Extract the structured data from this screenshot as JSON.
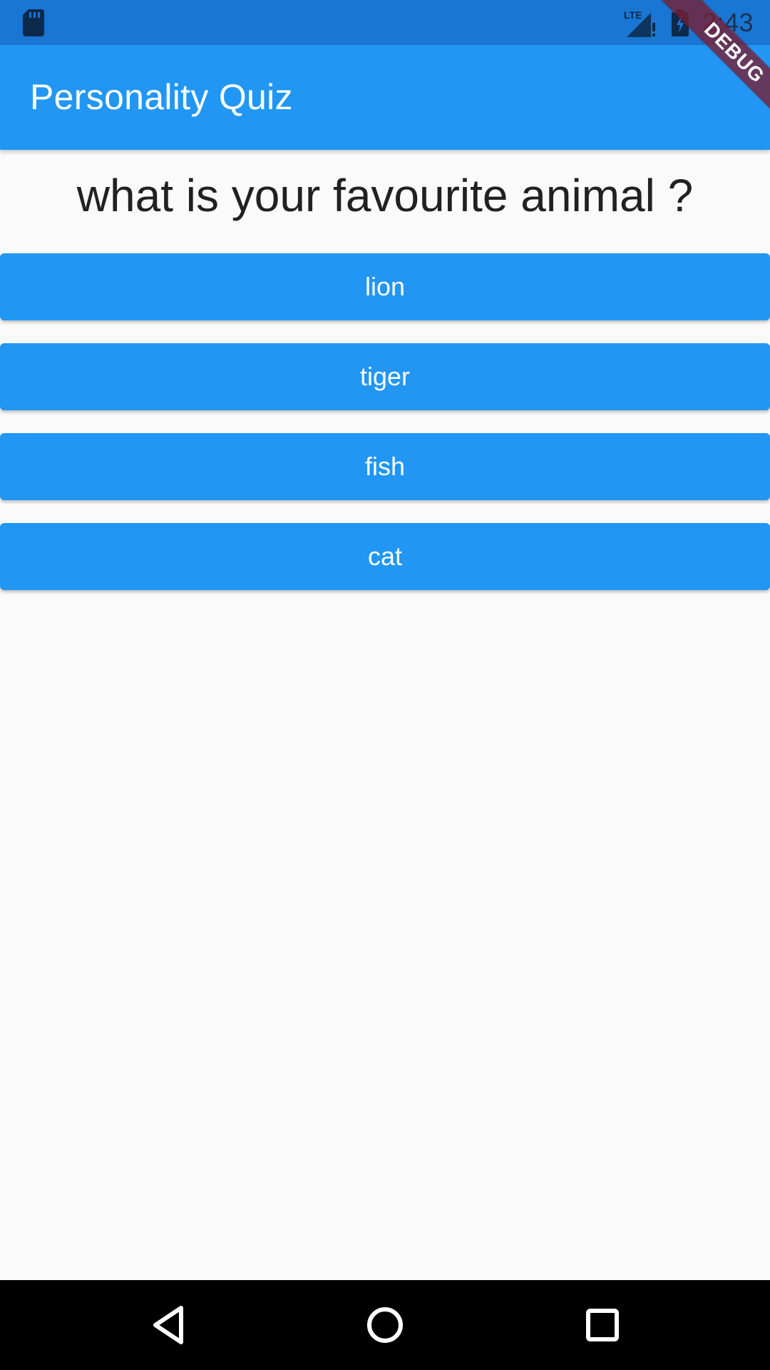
{
  "status_bar": {
    "time": "2:43",
    "network": "LTE",
    "icons": [
      "sd-card-icon",
      "signal-icon",
      "battery-charging-icon"
    ]
  },
  "app_bar": {
    "title": "Personality Quiz",
    "color": "#2196f3"
  },
  "debug_banner": {
    "label": "DEBUG"
  },
  "quiz": {
    "question": "what is your favourite animal ?",
    "answers": [
      "lion",
      "tiger",
      "fish",
      "cat"
    ]
  },
  "nav_bar": {
    "icons": [
      "back-icon",
      "home-icon",
      "recents-icon"
    ]
  },
  "colors": {
    "primary": "#2196f3",
    "status_bar": "#1976d2",
    "background": "#fafafa",
    "text": "#212121"
  }
}
